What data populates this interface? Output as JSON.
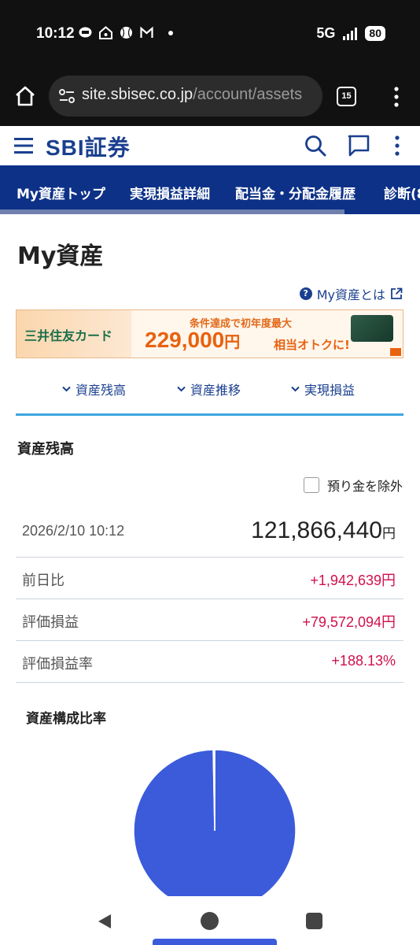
{
  "status_bar": {
    "time": "10:12",
    "network": "5G",
    "battery": "80",
    "icons": [
      "line-icon",
      "home-wifi-icon",
      "baseball-icon",
      "gmail-icon",
      "dot-icon",
      "signal-icon",
      "battery-icon"
    ]
  },
  "browser": {
    "url_host": "site.sbisec.co.jp",
    "url_path": "/account/assets",
    "tab_count": "15"
  },
  "site_header": {
    "logo": "SBI証券"
  },
  "nav": {
    "tabs": [
      {
        "label": "My資産トップ"
      },
      {
        "label": "実現損益詳細"
      },
      {
        "label": "配当金・分配金履歴"
      },
      {
        "label": "診断(8"
      }
    ]
  },
  "page": {
    "title": "My資産",
    "help_link": "My資産とは"
  },
  "banner": {
    "card_name": "三井住友カード",
    "subtitle": "条件達成で初年度最大",
    "amount": "229,000",
    "amount_unit": "円",
    "tagline": "相当オトクに!"
  },
  "anchors": [
    {
      "label": "資産残高"
    },
    {
      "label": "資産推移"
    },
    {
      "label": "実現損益"
    }
  ],
  "balance": {
    "section_title": "資産残高",
    "exclude_deposit_label": "預り金を除外",
    "exclude_deposit_checked": false,
    "datetime": "2026/2/10 10:12",
    "total": "121,866,440",
    "total_unit": "円",
    "rows": [
      {
        "label": "前日比",
        "value": "+1,942,639円"
      },
      {
        "label": "評価損益",
        "value": "+79,572,094円"
      },
      {
        "label": "評価損益率",
        "value": "+188.13%"
      }
    ]
  },
  "composition": {
    "title": "資産構成比率"
  },
  "chart_data": {
    "type": "pie",
    "title": "資産構成比率",
    "slices": [
      {
        "label": "",
        "value": 99.7,
        "color": "#3b5bdb"
      },
      {
        "label": "",
        "value": 0.3,
        "color": "#ffffff"
      }
    ]
  },
  "colors": {
    "brand": "#1a3f8f",
    "nav_bg": "#0d3187",
    "positive": "#d0104c",
    "accent_line": "#3ea6e0",
    "pie": "#3b5bdb"
  }
}
